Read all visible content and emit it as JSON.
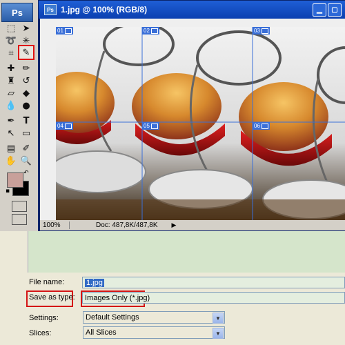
{
  "toolbox": {
    "logo": "Ps",
    "tools": [
      "marquee",
      "move",
      "lasso",
      "magic-wand",
      "crop",
      "slice",
      "healing",
      "brush",
      "stamp",
      "history-brush",
      "eraser",
      "paint-bucket",
      "blur",
      "dodge",
      "pen",
      "type",
      "path-select",
      "shape",
      "notes",
      "eyedropper",
      "hand",
      "zoom"
    ],
    "active_tool": "slice",
    "foreground_color": "#c8a09a",
    "background_color": "#000000"
  },
  "document": {
    "title": "1.jpg @ 100% (RGB/8)",
    "slices": [
      "01",
      "02",
      "03",
      "04",
      "05",
      "06"
    ],
    "zoom": "100%",
    "doc_size": "Doc: 487,8K/487,8K"
  },
  "dialog": {
    "file_name_label": "File name:",
    "file_name_value": "1.jpg",
    "save_type_label": "Save as type:",
    "save_type_value": "Images Only (*.jpg)",
    "settings_label": "Settings:",
    "settings_value": "Default Settings",
    "slices_label": "Slices:",
    "slices_value": "All Slices"
  },
  "colors": {
    "titlebar": "#1f5fd6",
    "highlight": "#d41515",
    "slice_guides": "#3a6fd8"
  }
}
